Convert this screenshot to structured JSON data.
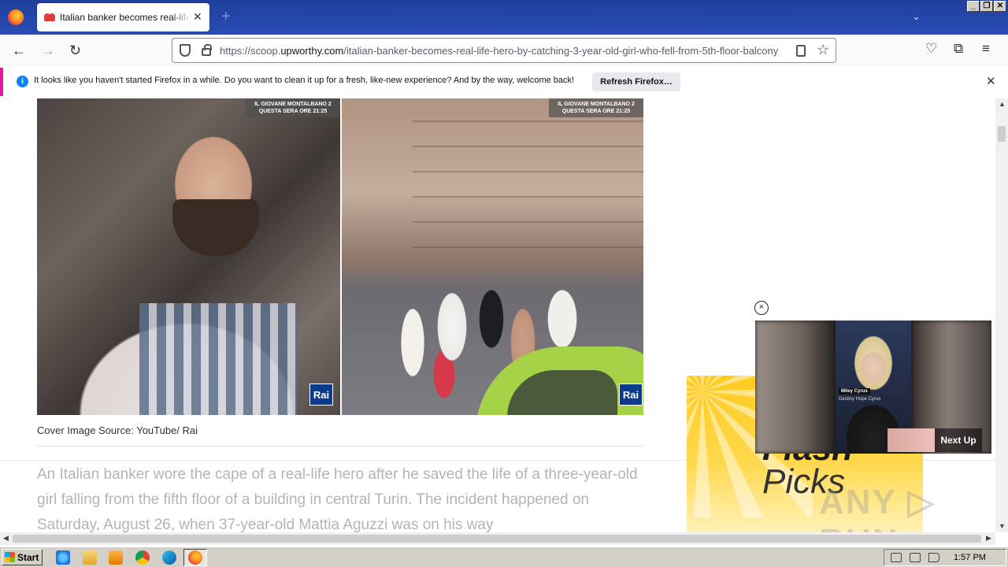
{
  "window": {
    "minimize": "_",
    "restore": "❐",
    "close": "✕"
  },
  "tab": {
    "title": "Italian banker becomes real-life hero",
    "close": "✕",
    "new_tab": "+",
    "list_all": "⌄"
  },
  "nav": {
    "back": "←",
    "forward": "→",
    "reload": "↻",
    "url_prefix": "https://scoop.",
    "url_domain": "upworthy.com",
    "url_path": "/italian-banker-becomes-real-life-hero-by-catching-3-year-old-girl-who-fell-from-5th-floor-balcony",
    "bookmark_star": "☆",
    "pocket": "♡",
    "extensions": "⧉",
    "menu": "≡"
  },
  "notification": {
    "icon": "i",
    "text": "It looks like you haven't started Firefox in a while. Do you want to clean it up for a fresh, like-new experience? And by the way, welcome back!",
    "button": "Refresh Firefox…",
    "close": "✕"
  },
  "article": {
    "image_overlay_left": "IL GIOVANE MONTALBANO 2 QUESTA SERA ORE 21:25",
    "image_overlay_right": "IL GIOVANE MONTALBANO 2 QUESTA SERA ORE 21:25",
    "logo_left": "Rai",
    "logo_right": "Rai",
    "caption": "Cover Image Source: YouTube/ Rai",
    "body": "An Italian banker wore the cape of a real-life hero after he saved the life of a three-year-old girl falling from the fifth floor of a building in central Turin. The incident happened on Saturday, August 26, when 37-year-old Mattia Aguzzi was on his way"
  },
  "ad": {
    "line1": "Flash",
    "line2": "Picks"
  },
  "video": {
    "close": "×",
    "name_tag": "Miley Cyrus",
    "sub_tag": "Destiny Hope Cyrus",
    "next_up": "Next Up"
  },
  "watermark": "ANY ▷ RUN",
  "scrollbars": {
    "up": "▲",
    "down": "▼",
    "left": "◀",
    "right": "▶"
  },
  "taskbar": {
    "start": "Start",
    "time": "1:57 PM",
    "icons": [
      "internet-explorer-icon",
      "file-explorer-icon",
      "media-player-icon",
      "chrome-icon",
      "edge-icon",
      "firefox-icon"
    ]
  },
  "colors": {
    "tabstrip": "#2a4db6",
    "notification_accent": "#e3199a",
    "info_blue": "#0a84ff",
    "ad_yellow": "#ffcb1f",
    "rai_blue": "#0d3b8c"
  }
}
